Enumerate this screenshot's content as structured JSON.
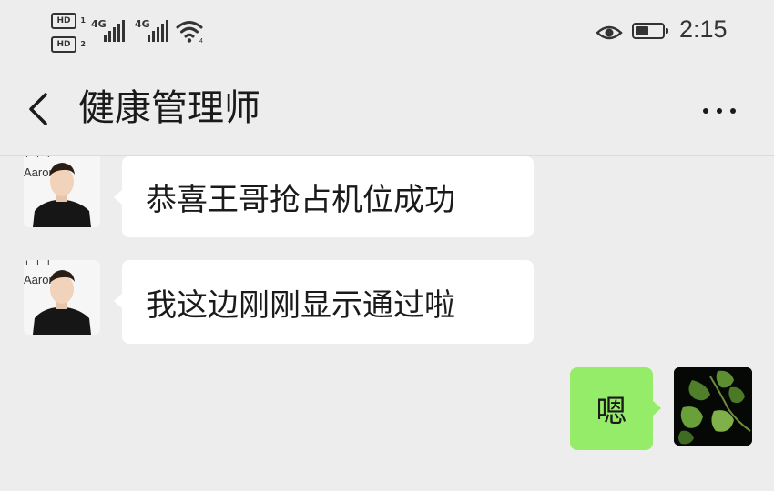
{
  "status_bar": {
    "hd1": "HD",
    "hd1_sim": "1",
    "hd2": "HD",
    "hd2_sim": "2",
    "network1": "4G",
    "network2": "4G",
    "time": "2:15",
    "battery_level": 0.5,
    "icons": [
      "hd-icon",
      "signal-icon",
      "wifi-icon",
      "eye-icon",
      "battery-icon"
    ]
  },
  "header": {
    "title": "健康管理师",
    "back_icon": "chevron-left-icon",
    "more_icon": "more-horizontal-icon"
  },
  "messages": [
    {
      "side": "incoming",
      "sender_label": "Aaron",
      "text": "恭喜王哥抢占机位成功"
    },
    {
      "side": "incoming",
      "sender_label": "Aaron",
      "text": "我这边刚刚显示通过啦"
    },
    {
      "side": "outgoing",
      "text": "嗯"
    }
  ],
  "colors": {
    "background": "#ededed",
    "incoming_bubble": "#ffffff",
    "outgoing_bubble": "#95ec69",
    "text": "#1a1a1a"
  }
}
